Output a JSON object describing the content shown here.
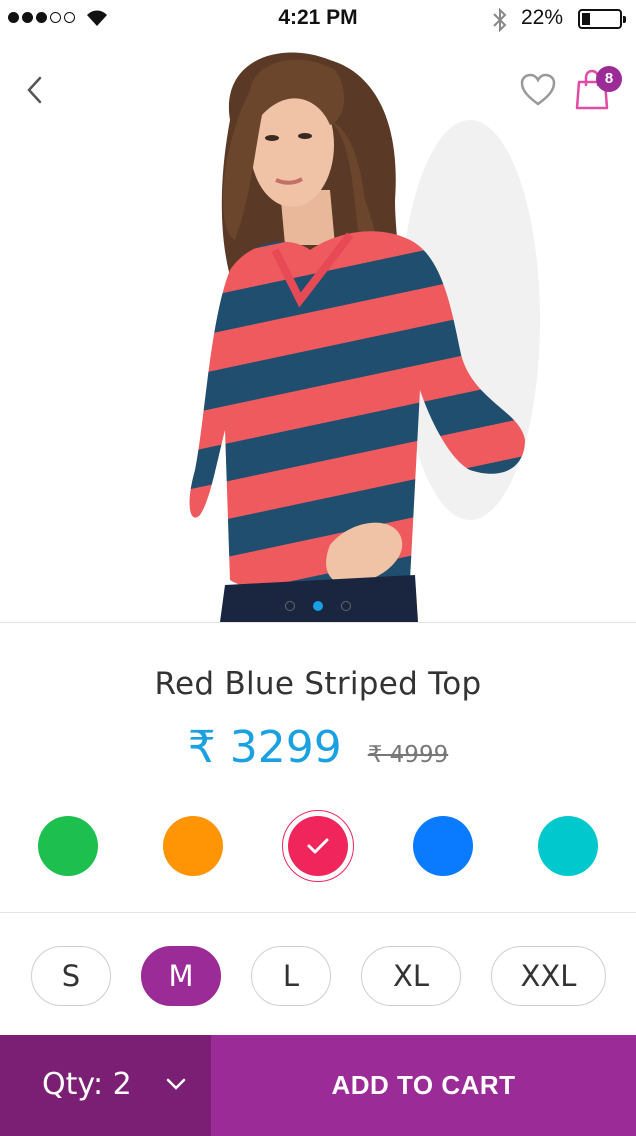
{
  "status_bar": {
    "signal_bars_filled": 3,
    "signal_bars_total": 5,
    "time": "4:21 PM",
    "battery_percent": "22%",
    "battery_level": 0.22
  },
  "header": {
    "back_icon": "chevron-left-icon",
    "wishlist_icon": "heart-outline-icon",
    "bag_icon": "shopping-bag-icon",
    "bag_count": "8"
  },
  "gallery": {
    "image_count": 3,
    "active_index": 1
  },
  "product": {
    "title": "Red Blue Striped Top",
    "price": "₹ 3299",
    "original_price": "₹ 4999"
  },
  "colors": [
    {
      "hex": "#1dbf4e",
      "selected": false
    },
    {
      "hex": "#ff9405",
      "selected": false
    },
    {
      "hex": "#f0255b",
      "selected": true
    },
    {
      "hex": "#0a7bff",
      "selected": false
    },
    {
      "hex": "#01c8cd",
      "selected": false
    }
  ],
  "sizes": [
    {
      "label": "S",
      "selected": false
    },
    {
      "label": "M",
      "selected": true
    },
    {
      "label": "L",
      "selected": false
    },
    {
      "label": "XL",
      "selected": false
    },
    {
      "label": "XXL",
      "selected": false
    }
  ],
  "footer": {
    "qty_label": "Qty: 2",
    "add_to_cart_label": "ADD TO CART"
  },
  "theme": {
    "accent": "#9b2b96",
    "accent_dark": "#7b1f75",
    "price_color": "#1ba0e1"
  }
}
